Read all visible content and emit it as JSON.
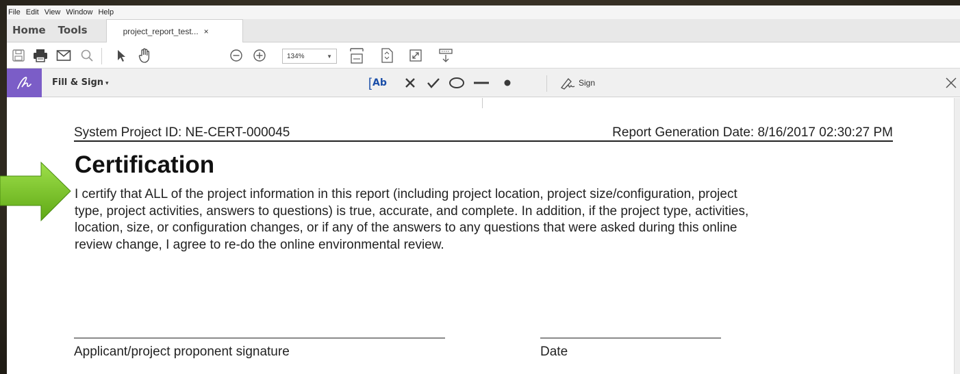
{
  "menu": [
    "File",
    "Edit",
    "View",
    "Window",
    "Help"
  ],
  "nav": {
    "home": "Home",
    "tools": "Tools",
    "doc_tab": {
      "label": "project_report_test...",
      "close": "×"
    }
  },
  "toolbar": {
    "icons": [
      "save-icon",
      "print-icon",
      "email-icon",
      "search-icon",
      "select-arrow-icon",
      "hand-icon",
      "zoom-out-icon",
      "zoom-in-icon",
      "fit-width-icon",
      "fit-page-icon",
      "full-screen-icon",
      "read-mode-icon"
    ],
    "zoom_value": "134%",
    "zoom_caret": "▼"
  },
  "fill_sign": {
    "label": "Fill & Sign",
    "caret": "▾",
    "text_tool": "Ab",
    "sign_label": "Sign",
    "tools": [
      "add-text-icon",
      "cross-mark-icon",
      "check-mark-icon",
      "circle-icon",
      "line-icon",
      "dot-icon",
      "sign-icon"
    ],
    "close": "×",
    "accent_color": "#7b5dc7"
  },
  "document": {
    "project_id": "System Project ID: NE-CERT-000045",
    "generation_date": "Report Generation Date: 8/16/2017 02:30:27 PM",
    "title": "Certification",
    "body_lines": [
      "I certify that ALL of the project information in this report (including project location, project size/configuration, project",
      "type, project activities, answers to questions) is true, accurate, and complete.  In addition, if the project type, activities,",
      "location, size, or configuration changes, or if any of the answers to any questions that were asked during this online",
      "review change, I agree to re-do the online environmental review."
    ],
    "signature_label": "Applicant/project proponent signature",
    "date_label": "Date"
  },
  "overlay": {
    "arrow_color": "#7cc519"
  }
}
